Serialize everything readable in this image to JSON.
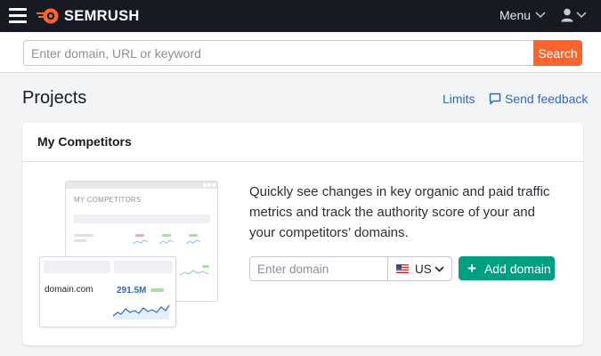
{
  "topbar": {
    "brand": "SEMRUSH",
    "menu_label": "Menu",
    "icons": [
      "hamburger-menu-icon",
      "semrush-logo-icon",
      "chevron-down-icon",
      "user-icon"
    ]
  },
  "search": {
    "placeholder": "Enter domain, URL or keyword",
    "value": "",
    "button_label": "Search"
  },
  "header": {
    "title": "Projects",
    "limits_label": "Limits",
    "feedback_label": "Send feedback"
  },
  "card": {
    "title": "My Competitors",
    "description": "Quickly see changes in key organic and paid traffic metrics and track the authority score of your and your competitors’ domains.",
    "illustration": {
      "title": "MY COMPETITORS",
      "domain": "domain.com",
      "value": "291.5M"
    },
    "domain_placeholder": "Enter domain",
    "domain_value": "",
    "country_code": "US",
    "add_button_label": "Add domain"
  },
  "colors": {
    "topbar": "#171a22",
    "brand_orange": "#ff642d",
    "link_blue": "#2b6bbf",
    "add_green": "#009f81",
    "background": "#f3f4f6"
  }
}
